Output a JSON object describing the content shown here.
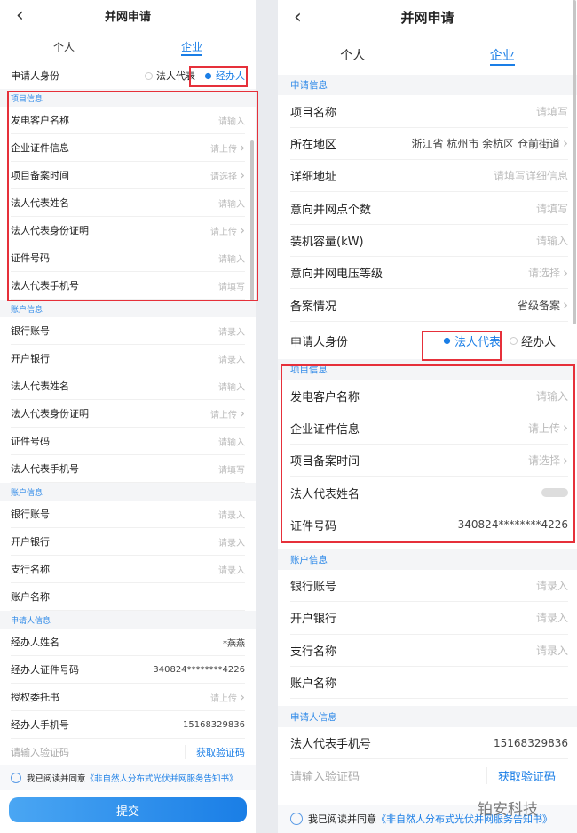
{
  "left": {
    "title": "并网申请",
    "tabs": [
      "个人",
      "企业"
    ],
    "active_tab": 1,
    "identity": {
      "label": "申请人身份",
      "options": [
        "法人代表",
        "经办人"
      ],
      "selected": 1
    },
    "groups": [
      {
        "title": "项目信息",
        "rows": [
          {
            "label": "发电客户名称",
            "value": "请输入"
          },
          {
            "label": "企业证件信息",
            "value": "请上传",
            "chevron": true
          },
          {
            "label": "项目备案时间",
            "value": "请选择",
            "chevron": true
          },
          {
            "label": "法人代表姓名",
            "value": "请输入"
          },
          {
            "label": "法人代表身份证明",
            "value": "请上传",
            "chevron": true
          },
          {
            "label": "证件号码",
            "value": "请输入"
          },
          {
            "label": "法人代表手机号",
            "value": "请填写"
          }
        ]
      },
      {
        "title": "账户信息",
        "rows": [
          {
            "label": "银行账号",
            "value": "请录入"
          },
          {
            "label": "开户银行",
            "value": "请录入"
          },
          {
            "label": "法人代表姓名",
            "value": "请输入"
          },
          {
            "label": "法人代表身份证明",
            "value": "请上传",
            "chevron": true
          },
          {
            "label": "证件号码",
            "value": "请输入"
          },
          {
            "label": "法人代表手机号",
            "value": "请填写"
          }
        ]
      },
      {
        "title": "账户信息",
        "rows": [
          {
            "label": "银行账号",
            "value": "请录入"
          },
          {
            "label": "开户银行",
            "value": "请录入"
          },
          {
            "label": "支行名称",
            "value": "请录入"
          },
          {
            "label": "账户名称",
            "value": ""
          }
        ]
      },
      {
        "title": "申请人信息",
        "rows": [
          {
            "label": "经办人姓名",
            "value": "*燕燕",
            "filled": true
          },
          {
            "label": "经办人证件号码",
            "value": "340824********4226",
            "filled": true
          },
          {
            "label": "授权委托书",
            "value": "请上传",
            "chevron": true
          },
          {
            "label": "经办人手机号",
            "value": "15168329836",
            "filled": true
          }
        ]
      }
    ],
    "code": {
      "placeholder": "请输入验证码",
      "button": "获取验证码"
    },
    "agree": {
      "text": "我已阅读并同意",
      "link": "《非自然人分布式光伏并网服务告知书》"
    },
    "submit": "提交"
  },
  "right": {
    "title": "并网申请",
    "tabs": [
      "个人",
      "企业"
    ],
    "active_tab": 1,
    "apply_group": {
      "title": "申请信息",
      "rows": [
        {
          "label": "项目名称",
          "value": "请填写"
        },
        {
          "label": "所在地区",
          "value": "浙江省 杭州市 余杭区 仓前街道",
          "chevron": true,
          "filled": true
        },
        {
          "label": "详细地址",
          "value": "请填写详细信息"
        },
        {
          "label": "意向并网点个数",
          "value": "请填写"
        },
        {
          "label": "装机容量(kW)",
          "value": "请输入"
        },
        {
          "label": "意向并网电压等级",
          "value": "请选择",
          "chevron": true
        },
        {
          "label": "备案情况",
          "value": "省级备案",
          "chevron": true,
          "filled": true
        }
      ]
    },
    "identity": {
      "label": "申请人身份",
      "options": [
        "法人代表",
        "经办人"
      ],
      "selected": 0
    },
    "groups": [
      {
        "title": "项目信息",
        "rows": [
          {
            "label": "发电客户名称",
            "value": "请输入"
          },
          {
            "label": "企业证件信息",
            "value": "请上传",
            "chevron": true
          },
          {
            "label": "项目备案时间",
            "value": "请选择",
            "chevron": true
          },
          {
            "label": "法人代表姓名",
            "value": "",
            "masked": true
          },
          {
            "label": "证件号码",
            "value": "340824********4226",
            "filled": true
          }
        ]
      },
      {
        "title": "账户信息",
        "rows": [
          {
            "label": "银行账号",
            "value": "请录入"
          },
          {
            "label": "开户银行",
            "value": "请录入"
          },
          {
            "label": "支行名称",
            "value": "请录入"
          },
          {
            "label": "账户名称",
            "value": ""
          }
        ]
      },
      {
        "title": "申请人信息",
        "rows": [
          {
            "label": "法人代表手机号",
            "value": "15168329836",
            "filled": true
          }
        ]
      }
    ],
    "code": {
      "placeholder": "请输入验证码",
      "button": "获取验证码"
    },
    "agree": {
      "text": "我已阅读并同意",
      "link": "《非自然人分布式光伏并网服务告知书》"
    }
  },
  "watermark": "铂安科技",
  "colors": {
    "accent": "#1a7ee6",
    "highlight": "#e6303a"
  }
}
